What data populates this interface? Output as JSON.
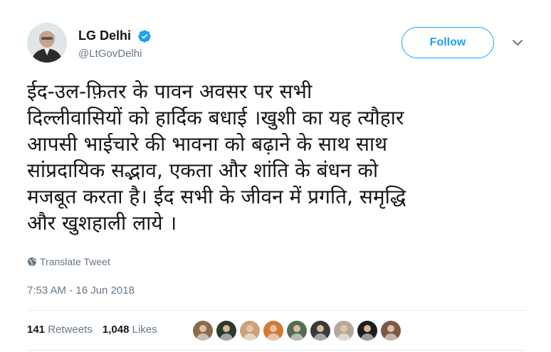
{
  "author": {
    "display_name": "LG Delhi",
    "handle": "@LtGovDelhi",
    "verified": true,
    "verified_icon": "verified-badge-icon"
  },
  "follow_button": {
    "label": "Follow"
  },
  "menu": {
    "icon": "chevron-down-icon"
  },
  "tweet": {
    "text": "ईद-उल-फ़ितर के पावन अवसर पर सभी\nदिल्लीवासियों को हार्दिक बधाई ।खुशी का यह त्यौहार\nआपसी भाईचारे की भावना को बढ़ाने के साथ साथ\nसांप्रदायिक सद्भाव, एकता और शांति के बंधन को\nमजबूत करता है। ईद सभी के जीवन में  प्रगति, समृद्धि\nऔर खुशहाली लाये ।"
  },
  "translate": {
    "label": "Translate Tweet",
    "icon": "globe-icon"
  },
  "timestamp": "7:53 AM - 16 Jun 2018",
  "stats": {
    "retweets_count": "141",
    "retweets_label": "Retweets",
    "likes_count": "1,048",
    "likes_label": "Likes"
  },
  "colors": {
    "accent": "#1da1f2",
    "secondary_text": "#657786",
    "divider": "#e6ecf0"
  },
  "likers": [
    {
      "color": "#8a6b4e"
    },
    {
      "color": "#2b3a2a"
    },
    {
      "color": "#c9a27c"
    },
    {
      "color": "#d07a3a"
    },
    {
      "color": "#556b55"
    },
    {
      "color": "#3a3a3a"
    },
    {
      "color": "#b3a89a"
    },
    {
      "color": "#1e1e1e"
    },
    {
      "color": "#7b5a45"
    }
  ]
}
